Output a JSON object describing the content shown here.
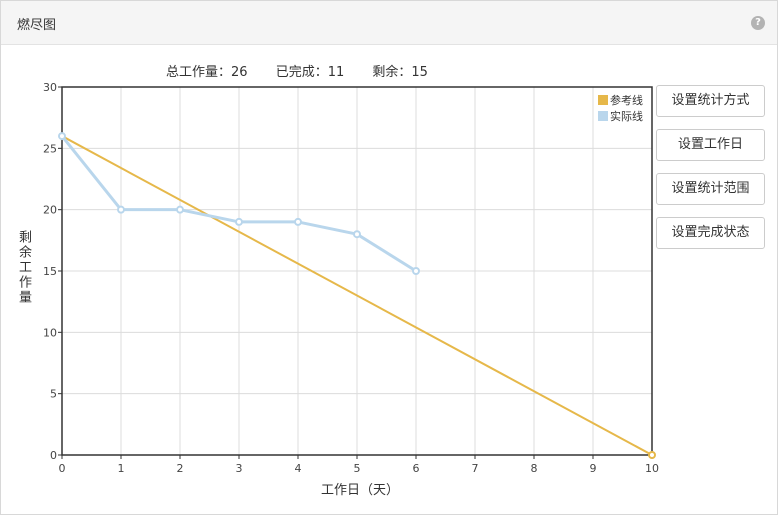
{
  "panel": {
    "title": "燃尽图",
    "help_icon": "?"
  },
  "summary": {
    "total": "总工作量：26",
    "done": "已完成：11",
    "remaining": "剩余：15"
  },
  "buttons": [
    {
      "label": "设置统计方式"
    },
    {
      "label": "设置工作日"
    },
    {
      "label": "设置统计范围"
    },
    {
      "label": "设置完成状态"
    }
  ],
  "chart_data": {
    "type": "line",
    "title": "",
    "xlabel": "工作日（天）",
    "ylabel": "剩余工作量",
    "xlim": [
      0,
      10
    ],
    "ylim": [
      0,
      30
    ],
    "xticks": [
      0,
      1,
      2,
      3,
      4,
      5,
      6,
      7,
      8,
      9,
      10
    ],
    "yticks": [
      0,
      5,
      10,
      15,
      20,
      25,
      30
    ],
    "grid": true,
    "legend": "top-right",
    "series": [
      {
        "name": "参考线",
        "color": "#e6b84a",
        "x": [
          0,
          10
        ],
        "y": [
          26,
          0
        ]
      },
      {
        "name": "实际线",
        "color": "#b9d6ec",
        "x": [
          0,
          1,
          2,
          3,
          4,
          5,
          6
        ],
        "y": [
          26,
          20,
          20,
          19,
          19,
          18,
          15
        ]
      }
    ]
  }
}
